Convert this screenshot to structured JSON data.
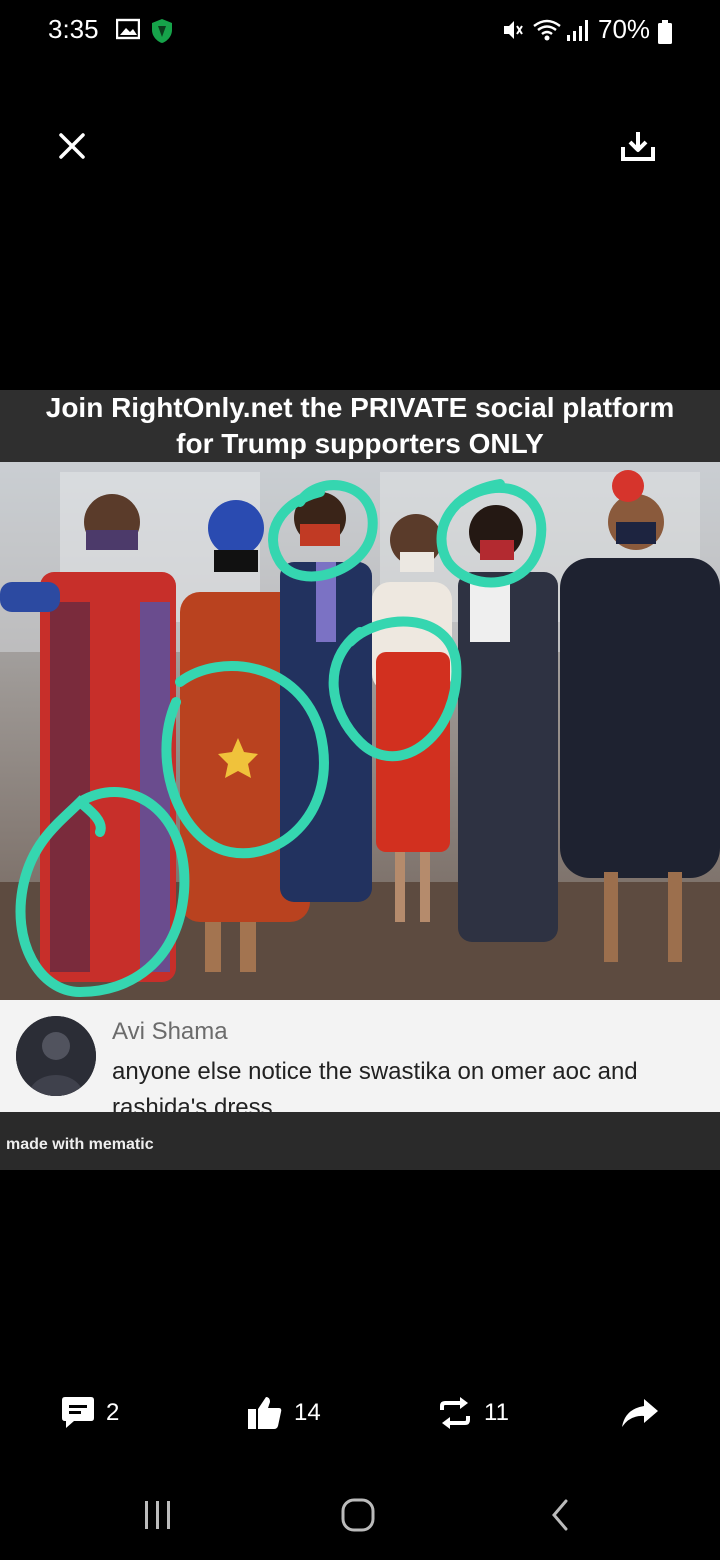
{
  "status_bar": {
    "time": "3:35",
    "battery": "70%",
    "icons": [
      "gallery-icon",
      "shield-icon",
      "mute-icon",
      "wifi-icon",
      "signal-icon",
      "battery-icon"
    ]
  },
  "toolbar": {
    "close_icon": "close-icon",
    "download_icon": "download-icon"
  },
  "meme": {
    "caption": "Join RightOnly.net the PRIVATE social platform for Trump supporters ONLY",
    "comment_name": "Avi Shama",
    "comment_text": "anyone else notice the swastika on omer aoc and rashida's dress",
    "watermark": "made with mematic",
    "highlight_color": "#35d6b0"
  },
  "actions": {
    "comments": "2",
    "likes": "14",
    "reposts": "11"
  },
  "colors": {
    "background": "#000000",
    "caption_bar": "#2f2f2f",
    "comment_bg": "#f3f3f3"
  }
}
